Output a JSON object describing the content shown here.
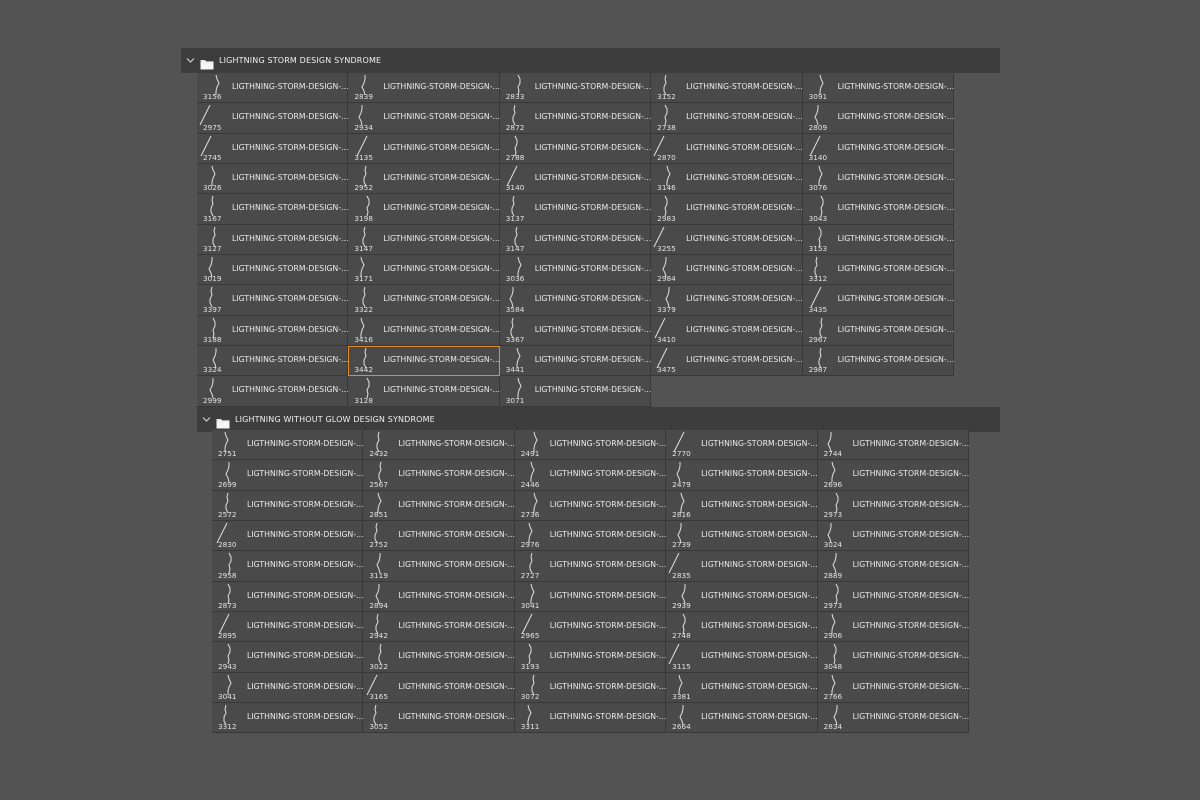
{
  "groups": [
    {
      "title": "LIGHTNING STORM DESIGN SYNDROME",
      "item_label": "LIGTHNING-STORM-DESIGN-...",
      "selected_index": 46,
      "sizes": [
        "3156",
        "2839",
        "2833",
        "3152",
        "3091",
        "2975",
        "2934",
        "2872",
        "2738",
        "2809",
        "2745",
        "3135",
        "2788",
        "2870",
        "3140",
        "3026",
        "2952",
        "3140",
        "3146",
        "3076",
        "3167",
        "3198",
        "3137",
        "2983",
        "3043",
        "3127",
        "3147",
        "3147",
        "3255",
        "3153",
        "3019",
        "3171",
        "3036",
        "2984",
        "3312",
        "3397",
        "3322",
        "3584",
        "3379",
        "3435",
        "3188",
        "3416",
        "3367",
        "3410",
        "2967",
        "3324",
        "3442",
        "3441",
        "3475",
        "2987",
        "2999",
        "3128",
        "3071"
      ]
    },
    {
      "title": "LIGHTNING WITHOUT GLOW DESIGN SYNDROME",
      "item_label": "LIGTHNING-STORM-DESIGN-...",
      "selected_index": -1,
      "sizes": [
        "2751",
        "2432",
        "2491",
        "2770",
        "2744",
        "2699",
        "2567",
        "2446",
        "2479",
        "2696",
        "2572",
        "2851",
        "2736",
        "2816",
        "2973",
        "2830",
        "2752",
        "2976",
        "2739",
        "3024",
        "2958",
        "3119",
        "2727",
        "2835",
        "2889",
        "2873",
        "2894",
        "3041",
        "2939",
        "2973",
        "2895",
        "2942",
        "2965",
        "2748",
        "2906",
        "2943",
        "3022",
        "3193",
        "3115",
        "3048",
        "3041",
        "3165",
        "3072",
        "3381",
        "2766",
        "3312",
        "3052",
        "3311",
        "2664",
        "2834"
      ]
    }
  ],
  "colors": {
    "background": "#535353",
    "header": "#3d3d3d",
    "cell": "#4a4a4a",
    "selection": "#e68a2e"
  },
  "icons": {
    "collapse": "chevron-down-icon",
    "group": "folder-icon",
    "preset": "lightning-brush-icon"
  }
}
